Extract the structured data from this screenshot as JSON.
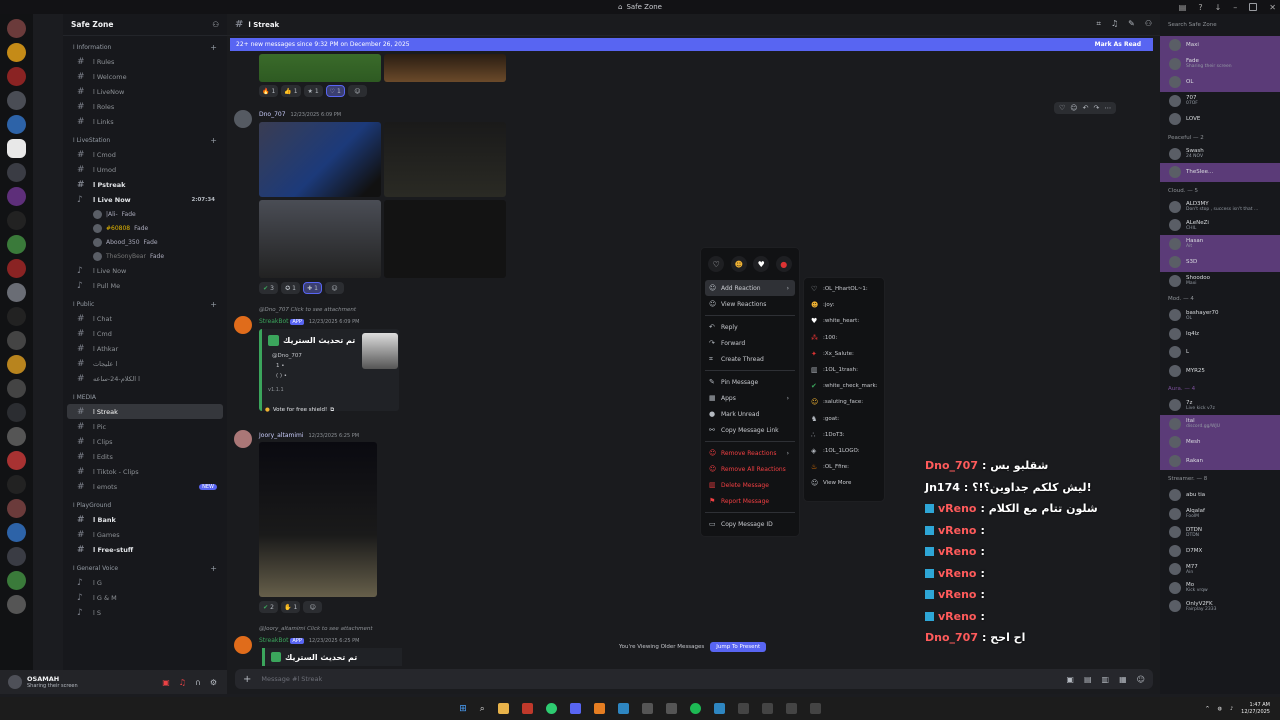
{
  "window": {
    "title": "Safe Zone"
  },
  "guild": {
    "name": "Safe Zone"
  },
  "channel": {
    "name": "ا Streak",
    "message_placeholder": "Message #ا Streak"
  },
  "banner": {
    "text": "22+ new messages since 9:32 PM on December 26, 2025",
    "mark_read": "Mark As Read"
  },
  "categories": [
    {
      "label": "ا Information",
      "channels": [
        {
          "name": "ا Rules"
        },
        {
          "name": "ا Welcome"
        },
        {
          "name": "ا LiveNow"
        },
        {
          "name": "ا Roles"
        },
        {
          "name": "ا Links"
        }
      ]
    },
    {
      "label": "ا LiveStation",
      "channels": [
        {
          "name": "ا Cmod"
        },
        {
          "name": "ا Umod"
        },
        {
          "name": "ا Pstreak"
        },
        {
          "name": "ا Live Now",
          "time": "2:07:34"
        }
      ]
    }
  ],
  "voice_users": [
    "|Ali-",
    "#60808",
    "Abood_350",
    "TheSonyBear"
  ],
  "voice_tags": [
    "Fade",
    "Fade",
    "Fade",
    "Fade"
  ],
  "categories2": [
    {
      "label": "ا Public",
      "channels": [
        {
          "name": "ا Chat"
        },
        {
          "name": "ا Cmd"
        },
        {
          "name": "ا Athkar"
        },
        {
          "name": "ا عليجات"
        },
        {
          "name": "ا الكلام-24-ساعه"
        }
      ]
    },
    {
      "label": "ا MEDIA",
      "channels": [
        {
          "name": "ا Streak"
        },
        {
          "name": "ا Pic"
        },
        {
          "name": "ا Clips"
        },
        {
          "name": "ا Edits"
        },
        {
          "name": "ا Tiktok - Clips"
        },
        {
          "name": "ا emots",
          "badge": "NEW"
        }
      ]
    },
    {
      "label": "ا PlayGround",
      "channels": [
        {
          "name": "ا Bank"
        },
        {
          "name": "ا Games"
        },
        {
          "name": "ا Free-stuff"
        }
      ]
    },
    {
      "label": "ا General Voice",
      "channels": [
        {
          "name": "ا G"
        },
        {
          "name": "ا G & M"
        },
        {
          "name": "ا S"
        }
      ]
    }
  ],
  "extra_voice": [
    {
      "name": "ا Live Now"
    },
    {
      "name": "ا Pull Me"
    }
  ],
  "user": {
    "name": "OSAMAH",
    "status": "Sharing their screen"
  },
  "messages": [
    {
      "author": "Dno_707",
      "ts": "12/23/2025 6:09 PM",
      "reactions": [
        "3",
        "1",
        "1"
      ]
    },
    {
      "author": "StreakBot",
      "tag": "APP",
      "ts": "12/23/2025 6:09 PM",
      "reply": "@Dno_707 Click to see attachment",
      "embed_title": "تم تحديث الستريك",
      "embed_user": "@Dno_707",
      "embed_line1": "1 •",
      "embed_line2": "( ) •",
      "embed_footer": "v1.1.1",
      "vote": "Vote for free shield!"
    },
    {
      "author": "Joory_altamimi",
      "ts": "12/23/2025 6:25 PM",
      "reactions": [
        "2",
        "1"
      ]
    },
    {
      "author": "StreakBot",
      "tag": "APP",
      "ts": "12/23/2025 6:25 PM",
      "reply": "@Joory_altamimi Click to see attachment",
      "embed_title": "تم تحديث الستريك"
    }
  ],
  "top_reactions": [
    "1",
    "1",
    "1",
    "1"
  ],
  "older": {
    "text": "You're Viewing Older Messages",
    "jump": "Jump To Present"
  },
  "context_menu": {
    "items": [
      "Add Reaction",
      "View Reactions",
      "Reply",
      "Forward",
      "Create Thread",
      "Pin Message",
      "Apps",
      "Mark Unread",
      "Copy Message Link",
      "Remove Reactions",
      "Remove All Reactions",
      "Delete Message",
      "Report Message",
      "Copy Message ID"
    ]
  },
  "reaction_submenu": [
    ":OL_HhartOL~1:",
    ":joy:",
    ":white_heart:",
    ":100:",
    ":Xx_Salute:",
    ":1OL_1trash:",
    ":white_check_mark:",
    ":saluting_face:",
    ":goat:",
    ":1DoT3:",
    ":1OL_1LOGO:",
    ":OL_Ffire:",
    "View More"
  ],
  "overlay": [
    {
      "name": "Dno_707",
      "msg": ": شقلبو بس"
    },
    {
      "name": "Jn174",
      "msg": ": ليش كلكم جداوين؟!؟!"
    },
    {
      "name": "vReno",
      "msg": ": شلون تتام مع الكلام"
    },
    {
      "name": "vReno",
      "msg": ":"
    },
    {
      "name": "vReno",
      "msg": ":"
    },
    {
      "name": "vReno",
      "msg": ":"
    },
    {
      "name": "vReno",
      "msg": ":"
    },
    {
      "name": "vReno",
      "msg": ":"
    },
    {
      "name": "Dno_707",
      "msg": ": اح احح"
    }
  ],
  "members": {
    "search": "Search Safe Zone",
    "groups": [
      {
        "label": "",
        "list": [
          {
            "n": "Maxi",
            "a": ""
          },
          {
            "n": "Fade",
            "a": "Sharing their screen"
          },
          {
            "n": "OL",
            "a": ""
          }
        ]
      },
      {
        "label": "",
        "list": [
          {
            "n": "707",
            "a": "07OF"
          },
          {
            "n": "LOVE",
            "a": ""
          }
        ]
      },
      {
        "label": "Peaceful — 2",
        "list": [
          {
            "n": "Swash",
            "a": "24 NOV"
          },
          {
            "n": "TheSlee...",
            "a": ""
          }
        ]
      },
      {
        "label": "Cloud. — 5",
        "list": [
          {
            "n": "ALD3MY",
            "a": "Don't stop , success isn't that ..."
          },
          {
            "n": "ALeNeZi",
            "a": "CHIL"
          },
          {
            "n": "Hasan",
            "a": "Ait"
          },
          {
            "n": "S3D",
            "a": ""
          },
          {
            "n": "Shoodoo",
            "a": "Maxi"
          }
        ]
      },
      {
        "label": "Mod. — 4",
        "list": [
          {
            "n": "bashayer70",
            "a": "OL"
          },
          {
            "n": "Iq4lz",
            "a": ""
          },
          {
            "n": "L",
            "a": ""
          },
          {
            "n": "MYR25",
            "a": ""
          }
        ]
      },
      {
        "label": "Aura. — 4",
        "list": [
          {
            "n": "7z",
            "a": "Live kick v7z"
          },
          {
            "n": "Ital",
            "a": "discord.gg/WJU"
          },
          {
            "n": "Mesh",
            "a": ""
          },
          {
            "n": "Rakan",
            "a": ""
          }
        ]
      },
      {
        "label": "Streamer. — 8",
        "list": [
          {
            "n": "abu tia",
            "a": ""
          },
          {
            "n": "Alqalaf",
            "a": "FoolM"
          },
          {
            "n": "DTDN",
            "a": "DTDN"
          },
          {
            "n": "D7MX",
            "a": ""
          },
          {
            "n": "M77",
            "a": "Ain"
          },
          {
            "n": "Mo",
            "a": "Kick vrqw"
          },
          {
            "n": "OnlyV2FK",
            "a": "Fairplay 2333"
          }
        ]
      }
    ]
  },
  "clock": {
    "time": "1:47 AM",
    "date": "12/27/2025"
  }
}
